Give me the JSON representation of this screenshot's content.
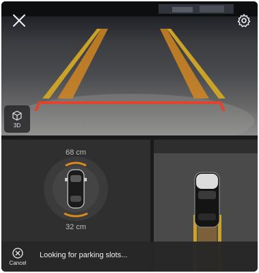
{
  "camera": {
    "close_icon": "close-icon",
    "settings_icon": "gear-icon",
    "view_mode": {
      "icon": "cube-icon",
      "label": "3D"
    }
  },
  "sensor": {
    "front_distance": "68 cm",
    "rear_distance": "32 cm"
  },
  "status_bar": {
    "cancel": {
      "icon": "cancel-icon",
      "label": "Cancel"
    },
    "message": "Looking for parking slots..."
  },
  "colors": {
    "guide_yellow": "#c9a227",
    "guide_orange": "#d9891f",
    "guide_red": "#e0452a",
    "background_dark": "#2c2c2c"
  }
}
